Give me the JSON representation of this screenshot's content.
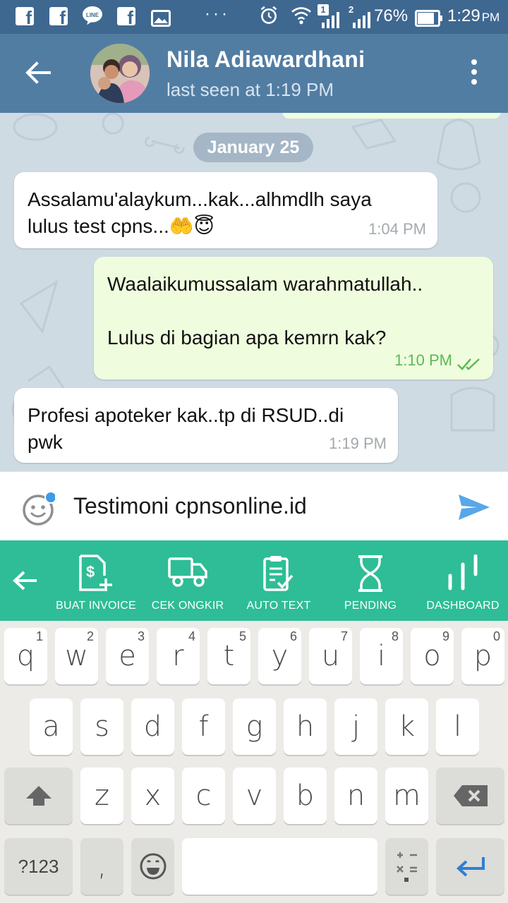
{
  "status_bar": {
    "line_label": "LINE",
    "battery": "76%",
    "time": "1:29",
    "time_suffix": "PM",
    "sim1_badge": "1",
    "sim2_badge": "2"
  },
  "header": {
    "contact_name": "Nila Adiawardhani",
    "contact_status": "last seen at 1:19 PM"
  },
  "chat": {
    "date_chip": "January 25",
    "messages": [
      {
        "direction": "in",
        "text": "Assalamu'alaykum...kak...alhmdlh saya\nlulus test cpns...🤲😇",
        "time": "1:04 PM"
      },
      {
        "direction": "out",
        "text": "Waalaikumussalam warahmatullah..\n\nLulus di bagian apa kemrn kak?",
        "time": "1:10 PM"
      },
      {
        "direction": "in",
        "text": "Profesi apoteker kak..tp di RSUD..di\npwk",
        "time": "1:19 PM"
      }
    ]
  },
  "input": {
    "value": "Testimoni cpnsonline.id"
  },
  "toolbar": {
    "items": [
      {
        "label": "BUAT INVOICE",
        "icon": "invoice-icon"
      },
      {
        "label": "CEK ONGKIR",
        "icon": "truck-icon"
      },
      {
        "label": "AUTO TEXT",
        "icon": "clipboard-icon"
      },
      {
        "label": "PENDING",
        "icon": "hourglass-icon"
      },
      {
        "label": "DASHBOARD",
        "icon": "bar-chart-icon"
      }
    ]
  },
  "keyboard": {
    "row1": [
      {
        "key": "q",
        "hint": "1"
      },
      {
        "key": "w",
        "hint": "2"
      },
      {
        "key": "e",
        "hint": "3"
      },
      {
        "key": "r",
        "hint": "4"
      },
      {
        "key": "t",
        "hint": "5"
      },
      {
        "key": "y",
        "hint": "6"
      },
      {
        "key": "u",
        "hint": "7"
      },
      {
        "key": "i",
        "hint": "8"
      },
      {
        "key": "o",
        "hint": "9"
      },
      {
        "key": "p",
        "hint": "0"
      }
    ],
    "row2": [
      "a",
      "s",
      "d",
      "f",
      "g",
      "h",
      "j",
      "k",
      "l"
    ],
    "row3": [
      "z",
      "x",
      "c",
      "v",
      "b",
      "n",
      "m"
    ],
    "symbols_key": "?123",
    "comma_key": ","
  }
}
